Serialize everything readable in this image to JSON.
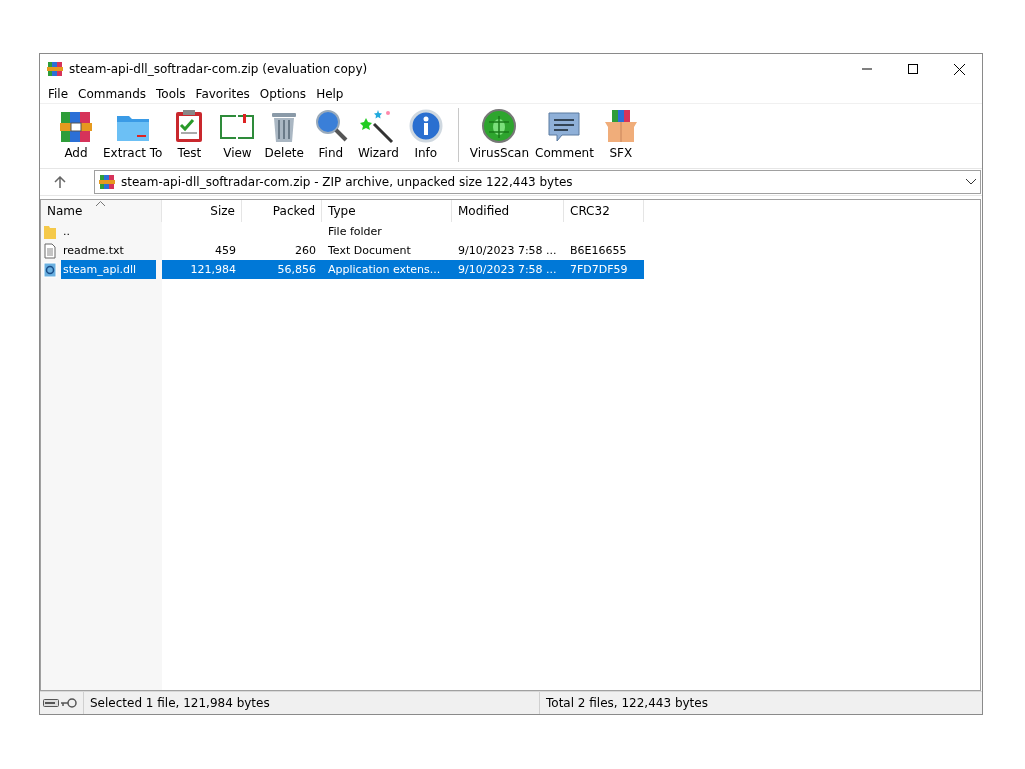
{
  "window": {
    "title": "steam-api-dll_softradar-com.zip (evaluation copy)"
  },
  "menu": [
    "File",
    "Commands",
    "Tools",
    "Favorites",
    "Options",
    "Help"
  ],
  "toolbar": [
    {
      "kind": "add",
      "label": "Add"
    },
    {
      "kind": "extract",
      "label": "Extract To"
    },
    {
      "kind": "test",
      "label": "Test"
    },
    {
      "kind": "view",
      "label": "View"
    },
    {
      "kind": "delete",
      "label": "Delete"
    },
    {
      "kind": "find",
      "label": "Find"
    },
    {
      "kind": "wizard",
      "label": "Wizard"
    },
    {
      "kind": "info",
      "label": "Info"
    },
    {
      "kind": "separator"
    },
    {
      "kind": "virusscan",
      "label": "VirusScan"
    },
    {
      "kind": "comment",
      "label": "Comment"
    },
    {
      "kind": "sfx",
      "label": "SFX"
    }
  ],
  "address": {
    "value": "steam-api-dll_softradar-com.zip - ZIP archive, unpacked size 122,443 bytes"
  },
  "table": {
    "columns": [
      {
        "label": "Name",
        "sorted": true
      },
      {
        "label": "Size",
        "sorted": false
      },
      {
        "label": "Packed",
        "sorted": false
      },
      {
        "label": "Type",
        "sorted": false
      },
      {
        "label": "Modified",
        "sorted": false
      },
      {
        "label": "CRC32",
        "sorted": false
      }
    ],
    "rows": [
      {
        "kind": "folder",
        "selected": false,
        "cells": [
          "..",
          "",
          "",
          "File folder",
          "",
          ""
        ]
      },
      {
        "kind": "text",
        "selected": false,
        "cells": [
          "readme.txt",
          "459",
          "260",
          "Text Document",
          "9/10/2023 7:58 ...",
          "B6E16655"
        ]
      },
      {
        "kind": "dll",
        "selected": true,
        "cells": [
          "steam_api.dll",
          "121,984",
          "56,856",
          "Application extens...",
          "9/10/2023 7:58 ...",
          "7FD7DF59"
        ]
      }
    ]
  },
  "status_bar": {
    "left": "Selected 1 file, 121,984 bytes",
    "right": "Total 2 files, 122,443 bytes"
  }
}
